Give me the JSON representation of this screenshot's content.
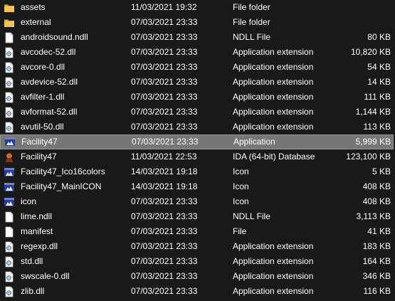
{
  "files": [
    {
      "name": "assets",
      "date": "11/03/2021 19:32",
      "type": "File folder",
      "size": "",
      "icon": "folder-icon"
    },
    {
      "name": "external",
      "date": "07/03/2021 23:33",
      "type": "File folder",
      "size": "",
      "icon": "folder-icon"
    },
    {
      "name": "androidsound.ndll",
      "date": "07/03/2021 23:33",
      "type": "NDLL File",
      "size": "80 KB",
      "icon": "file-icon"
    },
    {
      "name": "avcodec-52.dll",
      "date": "07/03/2021 23:33",
      "type": "Application extension",
      "size": "10,820 KB",
      "icon": "dll-icon"
    },
    {
      "name": "avcore-0.dll",
      "date": "07/03/2021 23:33",
      "type": "Application extension",
      "size": "54 KB",
      "icon": "dll-icon"
    },
    {
      "name": "avdevice-52.dll",
      "date": "07/03/2021 23:33",
      "type": "Application extension",
      "size": "14 KB",
      "icon": "dll-icon"
    },
    {
      "name": "avfilter-1.dll",
      "date": "07/03/2021 23:33",
      "type": "Application extension",
      "size": "111 KB",
      "icon": "dll-icon"
    },
    {
      "name": "avformat-52.dll",
      "date": "07/03/2021 23:33",
      "type": "Application extension",
      "size": "1,144 KB",
      "icon": "dll-icon"
    },
    {
      "name": "avutil-50.dll",
      "date": "07/03/2021 23:33",
      "type": "Application extension",
      "size": "113 KB",
      "icon": "dll-icon"
    },
    {
      "name": "Facility47",
      "date": "07/03/2021 23:33",
      "type": "Application",
      "size": "5,999 KB",
      "icon": "app-icon",
      "selected": true
    },
    {
      "name": "Facility47",
      "date": "11/03/2021 22:53",
      "type": "IDA (64-bit) Database",
      "size": "123,100 KB",
      "icon": "ida-database-icon"
    },
    {
      "name": "Facility47_Ico16colors",
      "date": "14/03/2021 19:18",
      "type": "Icon",
      "size": "5 KB",
      "icon": "app-icon"
    },
    {
      "name": "Facility47_MainICON",
      "date": "14/03/2021 19:18",
      "type": "Icon",
      "size": "408 KB",
      "icon": "app-icon"
    },
    {
      "name": "icon",
      "date": "07/03/2021 23:33",
      "type": "Icon",
      "size": "408 KB",
      "icon": "app-icon"
    },
    {
      "name": "lime.ndll",
      "date": "07/03/2021 23:33",
      "type": "NDLL File",
      "size": "3,113 KB",
      "icon": "file-icon"
    },
    {
      "name": "manifest",
      "date": "07/03/2021 23:33",
      "type": "File",
      "size": "41 KB",
      "icon": "file-icon"
    },
    {
      "name": "regexp.dll",
      "date": "07/03/2021 23:33",
      "type": "Application extension",
      "size": "183 KB",
      "icon": "dll-icon"
    },
    {
      "name": "std.dll",
      "date": "07/03/2021 23:33",
      "type": "Application extension",
      "size": "164 KB",
      "icon": "dll-icon"
    },
    {
      "name": "swscale-0.dll",
      "date": "07/03/2021 23:33",
      "type": "Application extension",
      "size": "346 KB",
      "icon": "dll-icon"
    },
    {
      "name": "zlib.dll",
      "date": "07/03/2021 23:33",
      "type": "Application extension",
      "size": "116 KB",
      "icon": "dll-icon"
    }
  ],
  "colors": {
    "background": "#191919",
    "text": "#ffffff",
    "selected_row": "#777777",
    "folder": "#e8b94a"
  }
}
